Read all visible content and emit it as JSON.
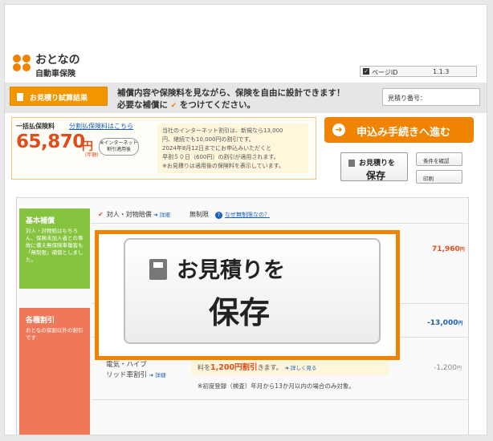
{
  "header": {
    "logo_line1": "おとなの",
    "logo_line2": "自動車保険",
    "page_id_label": "ページID",
    "page_id_value": "1.1.3"
  },
  "title_bar": {
    "result_button": "お見積り試算結果",
    "message_line1": "補償内容や保険料を見ながら、保険を自由に設計できます！",
    "message_line2_pre": "必要な補償に",
    "message_line2_check": "✔",
    "message_line2_post": "をつけてください。",
    "quote_number_label": "見積り番号："
  },
  "premium": {
    "label": "一括払保険料",
    "installment_link": "分割払保険料はこちら",
    "amount": "65,870",
    "yen": "円",
    "per_year": "(年額)",
    "internet_note_l1": "※インターネット",
    "internet_note_l2": "割引適用後",
    "discount_lines": [
      "当社のインターネット割引は、新規なら13,000",
      "円、継続でも10,000円の割引です。",
      "2024年8月12日までにお申込みいただくと",
      "早割５０日（600円）の割引が適用されます。",
      "※お見積りは適用後の保険料を表示しています。"
    ]
  },
  "actions": {
    "apply_label": "申込み手続きへ進む",
    "save_l1": "お見積りを",
    "save_l2": "保存",
    "confirm_conditions": "条件を確認",
    "print": "印刷"
  },
  "sections": {
    "basic": {
      "title": "基本補償",
      "desc": "対人・対物賠はもちろん、保険未加入者との事故に備え無保険車傷害も「無制限」補償としました。",
      "item_label": "対人・対物賠償",
      "detail": "詳細",
      "unlimited": "無制限",
      "why_link": "なぜ無制限なの？",
      "amount": "71,960",
      "yen": "円"
    },
    "discounts": {
      "title": "各種割引",
      "desc": "おとなの保割以外の割引です",
      "amount": "-13,000",
      "yen": "円",
      "hybrid_l1": "電気・ハイブ",
      "hybrid_l2": "リッド車割引",
      "detail": "詳細",
      "hybrid_pre": "料を",
      "hybrid_amount": "1,200円割引",
      "hybrid_post": "きます。",
      "hybrid_link": "詳しく見る",
      "hybrid_note": "※初度登録（検査）年月から13か月以内の場合のみ対象。",
      "hybrid_value": "-1,200",
      "hybrid_yen": "円"
    }
  },
  "callout": {
    "line1": "お見積りを",
    "line2": "保存"
  }
}
